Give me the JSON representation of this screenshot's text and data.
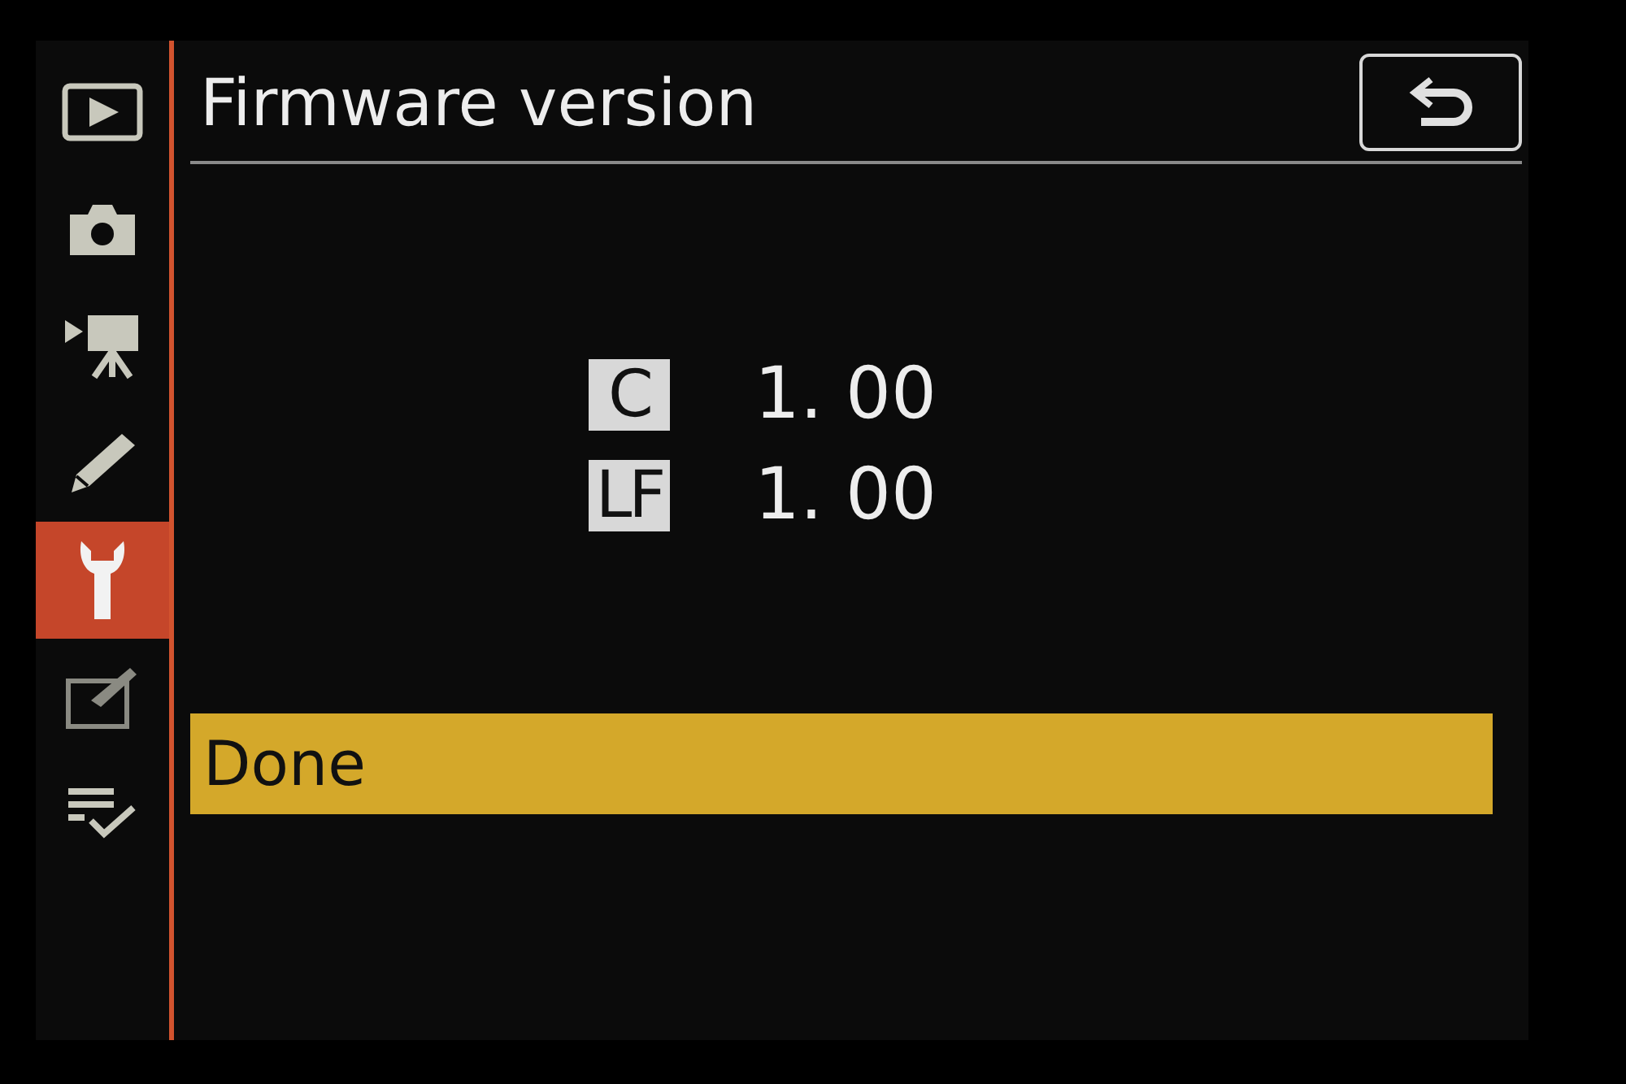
{
  "sidebar": {
    "items": [
      {
        "kind": "playback",
        "selected": false
      },
      {
        "kind": "photo",
        "selected": false
      },
      {
        "kind": "movie",
        "selected": false
      },
      {
        "kind": "custom",
        "selected": false
      },
      {
        "kind": "setup",
        "selected": true
      },
      {
        "kind": "retouch",
        "selected": false
      },
      {
        "kind": "mymenu",
        "selected": false
      }
    ]
  },
  "title": "Firmware version",
  "versions": [
    {
      "label": "C",
      "value": "1. 00"
    },
    {
      "label": "LF",
      "value": "1. 00"
    }
  ],
  "options": [
    {
      "label": "Done",
      "selected": true
    }
  ]
}
